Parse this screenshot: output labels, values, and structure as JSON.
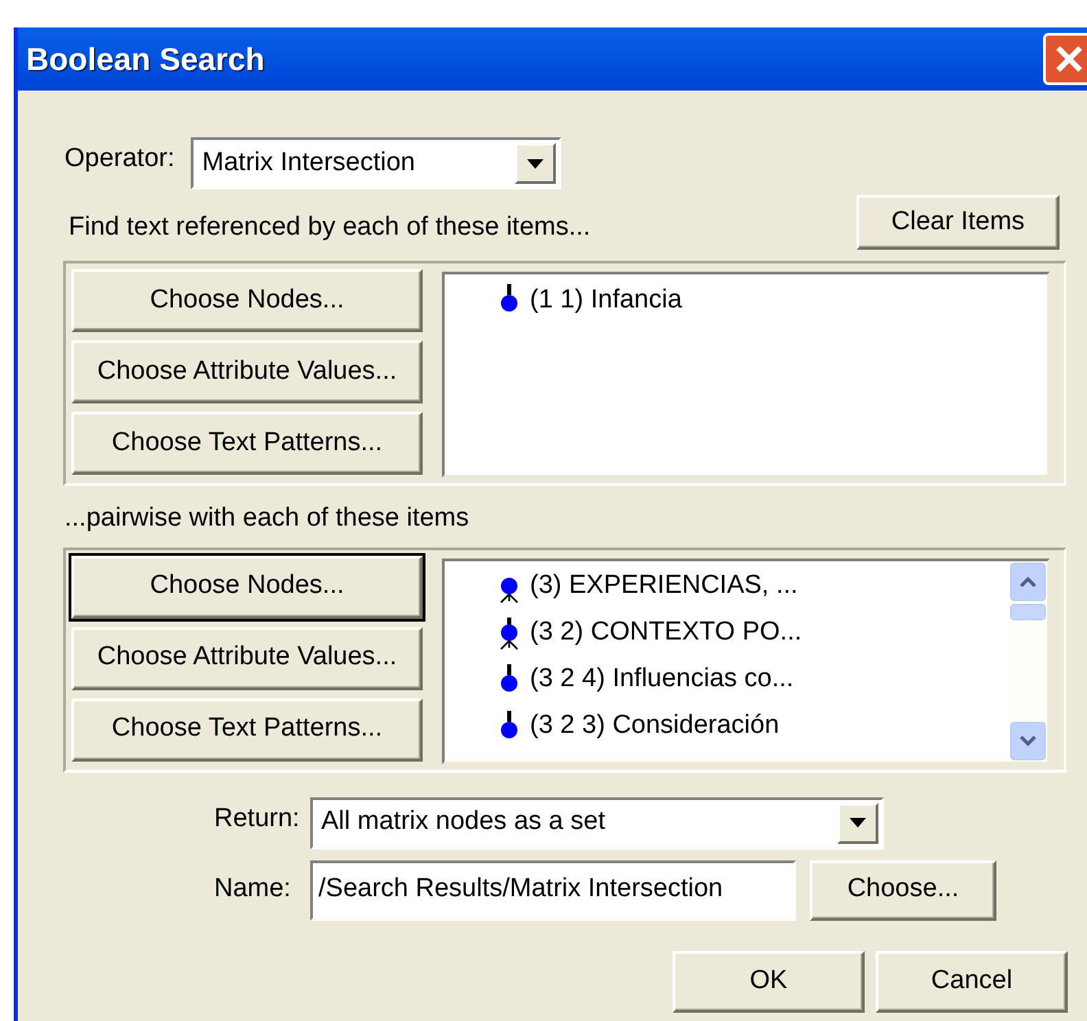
{
  "window": {
    "title": "Boolean Search"
  },
  "operator": {
    "label": "Operator:",
    "value": "Matrix Intersection"
  },
  "first_group": {
    "caption": "Find text referenced by each of these items...",
    "clear_button": "Clear Items",
    "buttons": [
      {
        "label": "Choose Nodes...",
        "focused": false
      },
      {
        "label": "Choose Attribute Values...",
        "focused": false
      },
      {
        "label": "Choose Text Patterns...",
        "focused": false
      }
    ],
    "items": [
      {
        "kind": "leaf",
        "label": "(1 1) Infancia"
      }
    ]
  },
  "second_group": {
    "caption": "...pairwise with each of these items",
    "buttons": [
      {
        "label": "Choose Nodes...",
        "focused": true
      },
      {
        "label": "Choose Attribute Values...",
        "focused": false
      },
      {
        "label": "Choose Text Patterns...",
        "focused": false
      }
    ],
    "items": [
      {
        "kind": "root",
        "label": "(3) EXPERIENCIAS, ..."
      },
      {
        "kind": "branch",
        "label": "(3 2) CONTEXTO PO..."
      },
      {
        "kind": "leaf",
        "label": "(3 2 4) Influencias co..."
      },
      {
        "kind": "leaf",
        "label": "(3 2 3) Consideración"
      }
    ]
  },
  "return": {
    "label": "Return:",
    "value": "All matrix nodes as a set"
  },
  "name": {
    "label": "Name:",
    "value": "/Search Results/Matrix Intersection",
    "choose_button": "Choose..."
  },
  "buttons": [
    "OK",
    "Cancel"
  ]
}
